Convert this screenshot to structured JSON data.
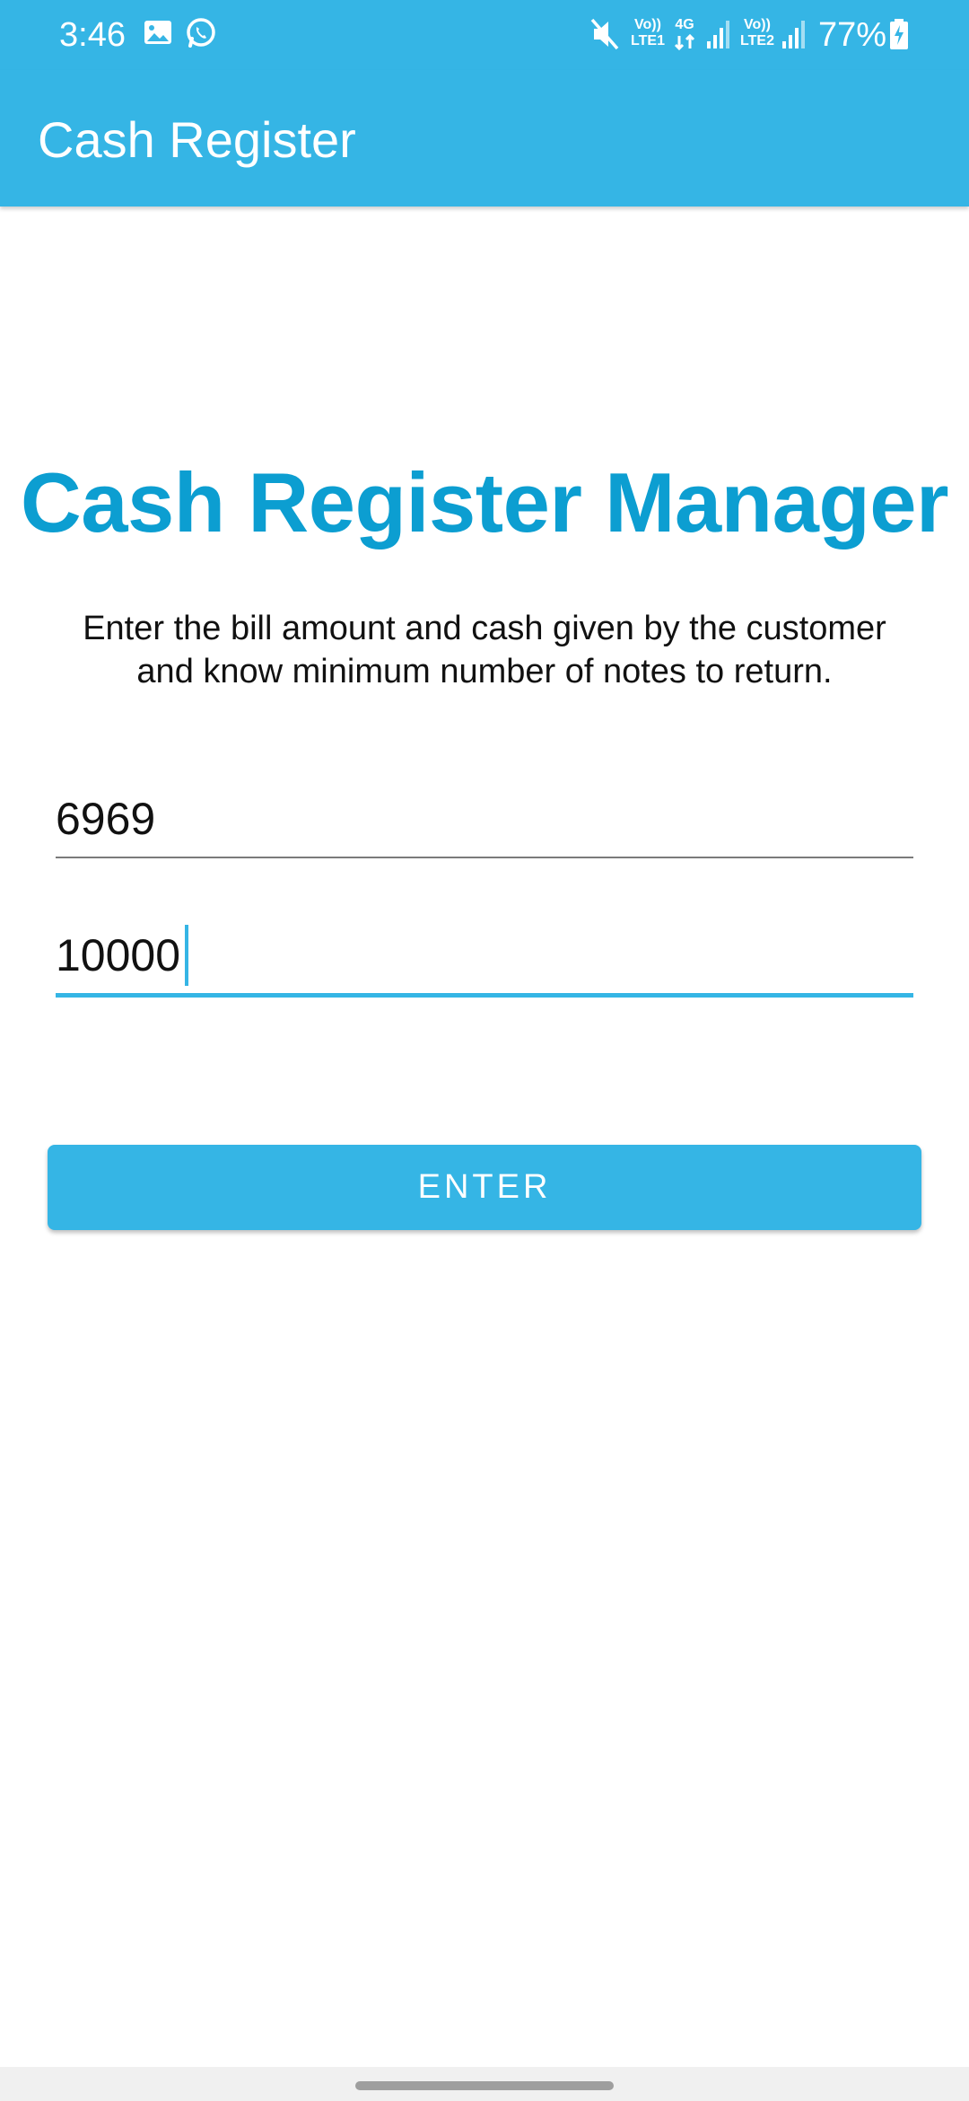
{
  "status_bar": {
    "time": "3:46",
    "battery": "77%",
    "sim1_label_top": "Vo))",
    "sim1_label_bottom": "LTE1",
    "network": "4G",
    "sim2_label_top": "Vo))",
    "sim2_label_bottom": "LTE2",
    "icons": [
      "image-notification-icon",
      "whatsapp-icon",
      "mute-icon",
      "data-arrows-icon",
      "signal-icon",
      "signal-icon",
      "battery-charging-icon"
    ]
  },
  "app_bar": {
    "title": "Cash Register"
  },
  "main": {
    "heading": "Cash Register Manager",
    "description": "Enter the bill amount and cash given by the customer and know minimum number of notes to return.",
    "bill_amount_value": "6969",
    "cash_given_value": "10000",
    "enter_label": "ENTER"
  },
  "colors": {
    "primary": "#35b5e5",
    "heading": "#0c9ed1",
    "text": "#111111"
  }
}
